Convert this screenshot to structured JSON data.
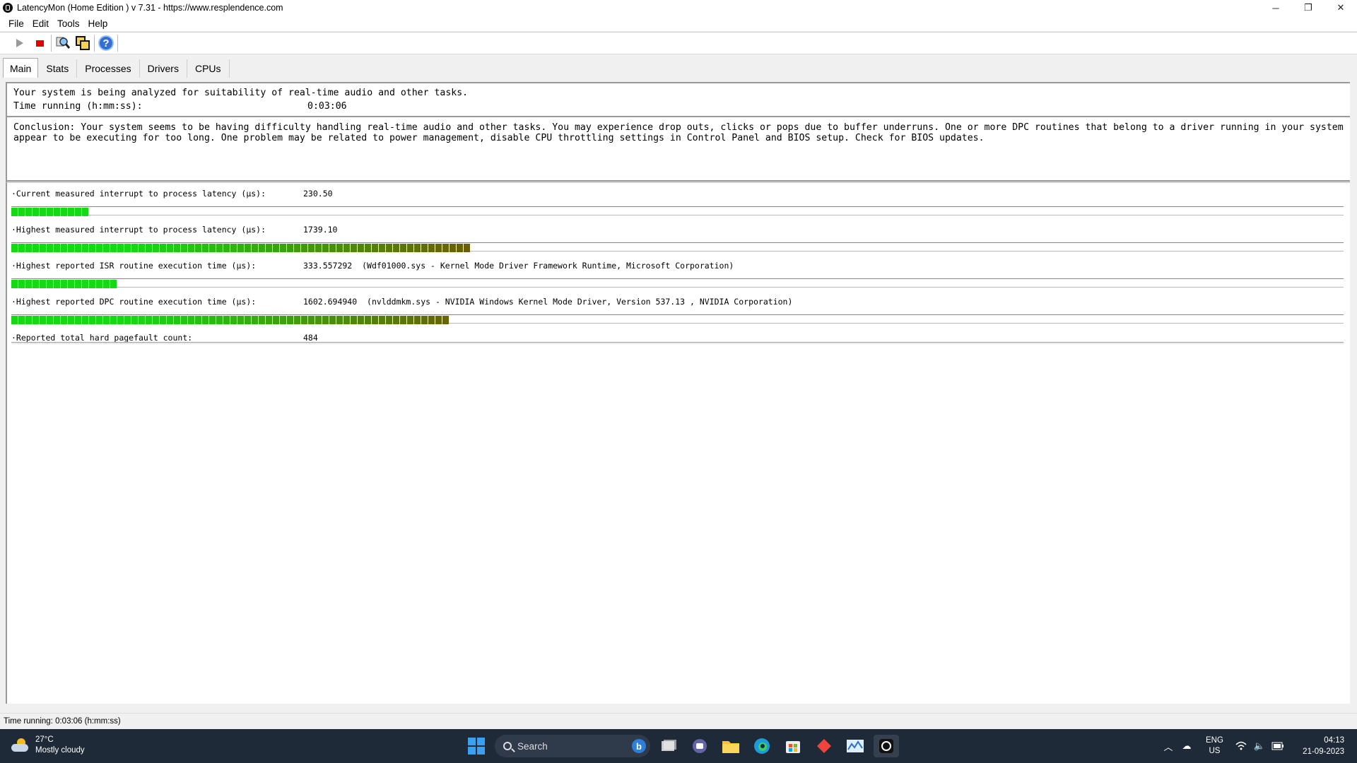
{
  "window": {
    "title": "LatencyMon  (Home Edition )  v 7.31 - https://www.resplendence.com",
    "minimize": "─",
    "maximize": "❐",
    "close": "✕"
  },
  "menu": [
    "File",
    "Edit",
    "Tools",
    "Help"
  ],
  "toolbar": {
    "start_icon": "play-icon",
    "stop_icon": "stop-icon",
    "inspect_icon": "magnifier-icon",
    "copy_icon": "copy-icon",
    "help_label": "?"
  },
  "tabs": [
    "Main",
    "Stats",
    "Processes",
    "Drivers",
    "CPUs"
  ],
  "status": {
    "analysis_line": "Your system is being analyzed for suitability of real-time audio and other tasks.",
    "time_label": "Time running (h:mm:ss):",
    "time_value": "0:03:06"
  },
  "conclusion": "Conclusion: Your system seems to be having difficulty handling real-time audio and other tasks. You may experience drop outs, clicks or pops due to buffer underruns. One or more DPC routines that belong to a driver running in your system appear to be executing for too long. One problem may be related to power management, disable CPU throttling settings in Control Panel and BIOS setup. Check for BIOS updates.",
  "metrics": [
    {
      "label": "·Current measured interrupt to process latency (µs):",
      "value": "230.50",
      "detail": "",
      "bar_segments": 11,
      "bar_fraction": 0.068
    },
    {
      "label": "·Highest measured interrupt to process latency (µs):",
      "value": "1739.10",
      "detail": "",
      "bar_segments": 65,
      "bar_fraction": 0.407
    },
    {
      "label": "·Highest reported ISR routine execution time (µs):",
      "value": "333.557292",
      "detail": "(Wdf01000.sys - Kernel Mode Driver Framework Runtime, Microsoft Corporation)",
      "bar_segments": 15,
      "bar_fraction": 0.095
    },
    {
      "label": "·Highest reported DPC routine execution time (µs):",
      "value": "1602.694940",
      "detail": "(nvlddmkm.sys - NVIDIA Windows Kernel Mode Driver, Version 537.13 , NVIDIA Corporation)",
      "bar_segments": 62,
      "bar_fraction": 0.388
    },
    {
      "label": "·Reported total hard pagefault count:",
      "value": "484",
      "detail": "",
      "bar_segments": 0,
      "bar_fraction": 0
    }
  ],
  "colors": {
    "bar_green": "#16d916",
    "bar_olive": "#6b5e0a"
  },
  "statusbar": "Time running: 0:03:06  (h:mm:ss)",
  "taskbar": {
    "temperature": "27°C",
    "weather": "Mostly cloudy",
    "search_label": "Search",
    "bing_label": "b",
    "lang_top": "ENG",
    "lang_bottom": "US",
    "time": "04:13",
    "date": "21-09-2023"
  }
}
